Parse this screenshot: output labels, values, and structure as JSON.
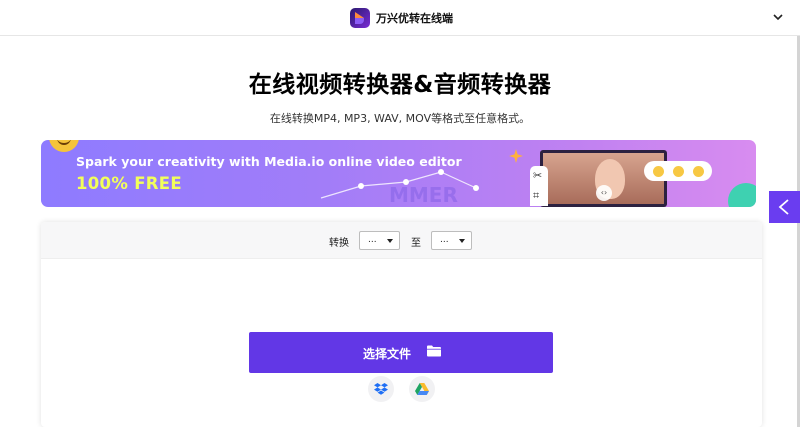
{
  "header": {
    "brand_name": "万兴优转在线端",
    "logo_icon": "uniconverter-logo-icon",
    "menu_icon": "chevron-down-icon"
  },
  "main": {
    "title": "在线视频转换器&音频转换器",
    "subtitle": "在线转换MP4, MP3, WAV, MOV等格式至任意格式。"
  },
  "banner": {
    "headline": "Spark your creativity with Media.io online video editor",
    "free_text": "100% FREE",
    "colors": {
      "start": "#8e7bff",
      "end": "#d88cf0",
      "free": "#f2ff5a"
    }
  },
  "converter": {
    "convert_label": "转换",
    "from_value": "...",
    "to_label": "至",
    "to_value": "...",
    "choose_file_label": "选择文件",
    "choose_file_icon": "folder-icon",
    "cloud_sources": [
      "dropbox-icon",
      "google-drive-icon"
    ],
    "accent_color": "#6237e6"
  },
  "side_tab": {
    "icon": "chevron-left-icon",
    "color": "#6a3df0"
  }
}
